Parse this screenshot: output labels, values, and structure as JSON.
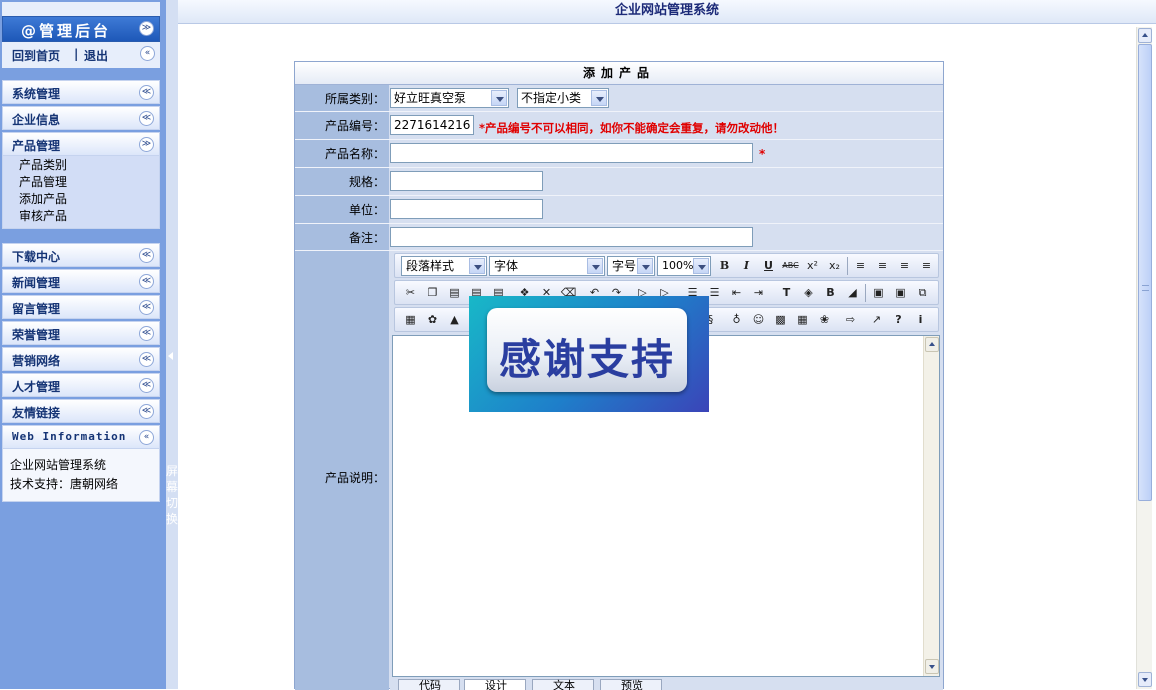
{
  "sidebar": {
    "title": "@管理后台",
    "links": {
      "home": "回到首页",
      "sep": "|",
      "logout": "退出"
    },
    "sections": [
      {
        "label": "系统管理",
        "expanded": false
      },
      {
        "label": "企业信息",
        "expanded": false
      },
      {
        "label": "产品管理",
        "expanded": true,
        "items": [
          "产品类别",
          "产品管理",
          "添加产品",
          "审核产品"
        ]
      },
      {
        "label": "下载中心",
        "expanded": false
      },
      {
        "label": "新闻管理",
        "expanded": false
      },
      {
        "label": "留言管理",
        "expanded": false
      },
      {
        "label": "荣誉管理",
        "expanded": false
      },
      {
        "label": "营销网络",
        "expanded": false
      },
      {
        "label": "人才管理",
        "expanded": false
      },
      {
        "label": "友情链接",
        "expanded": false
      }
    ],
    "web_info": {
      "label": "Web Information",
      "lines": [
        "企业网站管理系统",
        "技术支持：唐朝网络"
      ]
    }
  },
  "splitter": {
    "label": "屏幕切换"
  },
  "topbar": {
    "title": "企业网站管理系统"
  },
  "form": {
    "title": "添加产品",
    "category": {
      "label": "所属类别：",
      "main_value": "好立旺真空泵",
      "sub_value": "不指定小类"
    },
    "code": {
      "label": "产品编号：",
      "value": "2271614216",
      "warning": "*产品编号不可以相同，如你不能确定会重复，请勿改动他！"
    },
    "name": {
      "label": "产品名称：",
      "value": "",
      "required": "*"
    },
    "spec": {
      "label": "规格：",
      "value": ""
    },
    "unit": {
      "label": "单位：",
      "value": ""
    },
    "note": {
      "label": "备注：",
      "value": ""
    },
    "description": {
      "label": "产品说明："
    }
  },
  "editor": {
    "paragraph_style": "段落样式",
    "font": "字体",
    "font_size": "字号",
    "zoom": "100%",
    "mode_tabs": [
      "代码",
      "设计",
      "文本",
      "预览"
    ]
  },
  "overlay_badge": {
    "text": "感谢支持"
  },
  "colors": {
    "sidebar_bg": "#7a9fe0",
    "header_text": "#153475",
    "warning": "#e00000",
    "form_bg": "#d6dff0"
  }
}
